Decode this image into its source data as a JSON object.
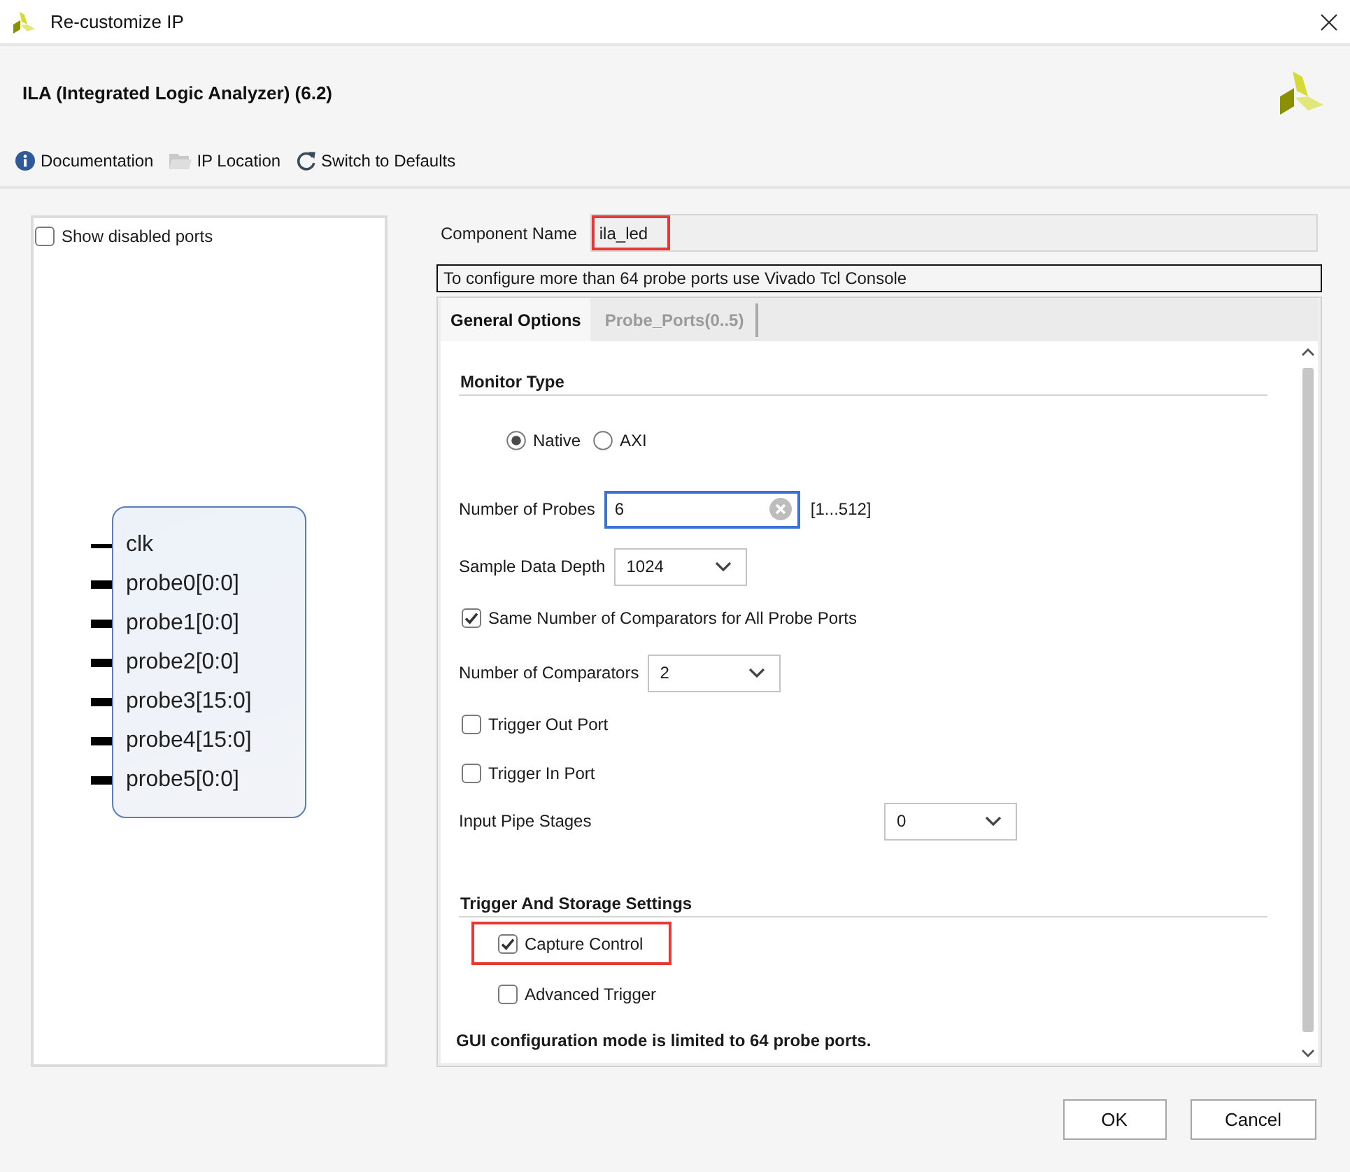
{
  "window": {
    "title": "Re-customize IP"
  },
  "header": {
    "title": "ILA (Integrated Logic Analyzer) (6.2)"
  },
  "toolbar": [
    {
      "label": "Documentation",
      "kind": "info"
    },
    {
      "label": "IP Location",
      "kind": "folder"
    },
    {
      "label": "Switch to Defaults",
      "kind": "reset"
    }
  ],
  "symbol_panel": {
    "show_disabled_ports": {
      "label": "Show disabled ports",
      "checked": false
    },
    "ports": [
      {
        "name": "clk",
        "kind": "wire"
      },
      {
        "name": "probe0[0:0]",
        "kind": "bus"
      },
      {
        "name": "probe1[0:0]",
        "kind": "bus"
      },
      {
        "name": "probe2[0:0]",
        "kind": "bus"
      },
      {
        "name": "probe3[15:0]",
        "kind": "bus"
      },
      {
        "name": "probe4[15:0]",
        "kind": "bus"
      },
      {
        "name": "probe5[0:0]",
        "kind": "bus"
      }
    ]
  },
  "component_name": {
    "label": "Component Name",
    "value": "ila_led",
    "highlighted": true
  },
  "notice": "To configure more than 64 probe ports use Vivado Tcl Console",
  "tabs": [
    {
      "label": "General Options",
      "selected": true
    },
    {
      "label": "Probe_Ports(0..5)",
      "selected": false
    }
  ],
  "general_options": {
    "sections": [
      {
        "title": "Monitor Type",
        "items": [
          {
            "kind": "radio_group",
            "options": [
              {
                "label": "Native",
                "selected": true
              },
              {
                "label": "AXI",
                "selected": false
              }
            ]
          },
          {
            "kind": "text_input",
            "label": "Number of Probes",
            "value": "6",
            "range": "[1...512]",
            "focused": true
          },
          {
            "kind": "dropdown",
            "label": "Sample Data Depth",
            "value": "1024"
          },
          {
            "kind": "checkbox",
            "label": "Same Number of Comparators for All Probe Ports",
            "checked": true,
            "highlighted": false
          },
          {
            "kind": "dropdown",
            "label": "Number of Comparators",
            "value": "2"
          },
          {
            "kind": "checkbox",
            "label": "Trigger Out Port",
            "checked": false,
            "highlighted": false
          },
          {
            "kind": "checkbox",
            "label": "Trigger In Port",
            "checked": false,
            "highlighted": false
          },
          {
            "kind": "grid_dropdown",
            "label": "Input Pipe Stages",
            "value": "0"
          }
        ]
      },
      {
        "title": "Trigger And Storage Settings",
        "items": [
          {
            "kind": "checkbox",
            "label": "Capture Control",
            "checked": true,
            "highlighted": true
          },
          {
            "kind": "checkbox",
            "label": "Advanced Trigger",
            "checked": false,
            "highlighted": false
          }
        ]
      }
    ],
    "note": "GUI configuration mode is limited to 64 probe ports."
  },
  "buttons": [
    "OK",
    "Cancel"
  ]
}
